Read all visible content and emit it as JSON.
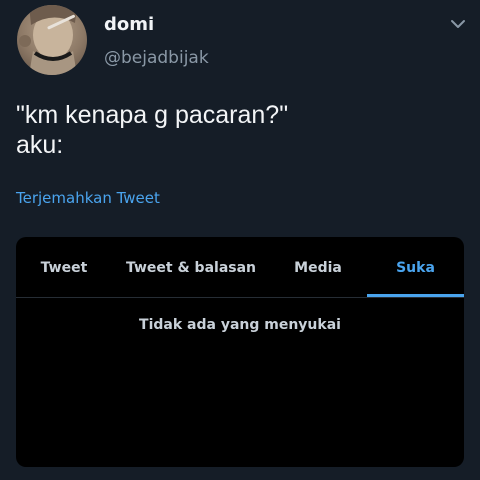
{
  "tweet": {
    "author": {
      "display_name": "domi",
      "handle": "@bejadbijak",
      "avatar_icon": "profile-photo"
    },
    "menu_icon": "chevron-down-icon",
    "text_lines": [
      "\"km kenapa g pacaran?\"",
      "aku:"
    ],
    "translate_label": "Terjemahkan Tweet"
  },
  "embedded": {
    "tabs": [
      {
        "label": "Tweet",
        "selected": false
      },
      {
        "label": "Tweet & balasan",
        "selected": false
      },
      {
        "label": "Media",
        "selected": false
      },
      {
        "label": "Suka",
        "selected": true
      }
    ],
    "empty_message": "Tidak ada yang menyukai"
  },
  "colors": {
    "background": "#151d27",
    "accent": "#4aa4ee",
    "card_background": "#000000",
    "primary_text": "#f1f4f7",
    "secondary_text": "#8a98a6"
  }
}
